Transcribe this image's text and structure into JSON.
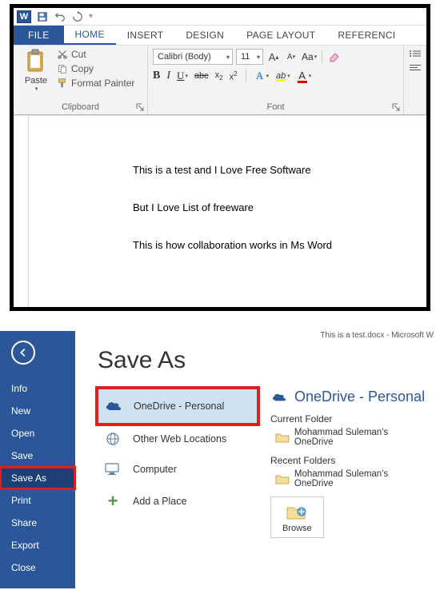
{
  "titlebar": {
    "app_label": "W"
  },
  "tabs": {
    "file": "FILE",
    "home": "HOME",
    "insert": "INSERT",
    "design": "DESIGN",
    "page_layout": "PAGE LAYOUT",
    "references": "REFERENCI"
  },
  "ribbon": {
    "clipboard": {
      "paste": "Paste",
      "cut": "Cut",
      "copy": "Copy",
      "format_painter": "Format Painter",
      "group_label": "Clipboard"
    },
    "font": {
      "font_name": "Calibri (Body)",
      "font_size": "11",
      "grow": "A",
      "shrink": "A",
      "case": "Aa",
      "bold": "B",
      "italic": "I",
      "underline": "U",
      "strike": "abc",
      "subscript": "x",
      "subscript_sub": "2",
      "superscript": "x",
      "superscript_sup": "2",
      "text_effects": "A",
      "highlight": "ab",
      "font_color": "A",
      "group_label": "Font"
    }
  },
  "document": {
    "p1": "This is a test and I Love Free Software",
    "p2": "But I Love List of freeware",
    "p3": "This is how collaboration works in Ms Word"
  },
  "backstage": {
    "window_title": "This is a test.docx - Microsoft W",
    "sidebar": {
      "info": "Info",
      "new": "New",
      "open": "Open",
      "save": "Save",
      "save_as": "Save As",
      "print": "Print",
      "share": "Share",
      "export": "Export",
      "close": "Close"
    },
    "heading": "Save As",
    "locations": {
      "onedrive": "OneDrive - Personal",
      "other_web": "Other Web Locations",
      "computer": "Computer",
      "add_place": "Add a Place"
    },
    "right": {
      "title": "OneDrive - Personal",
      "current_folder_label": "Current Folder",
      "current_folder": "Mohammad Suleman's OneDrive",
      "recent_folders_label": "Recent Folders",
      "recent_folder": "Mohammad Suleman's OneDrive",
      "browse": "Browse"
    }
  }
}
